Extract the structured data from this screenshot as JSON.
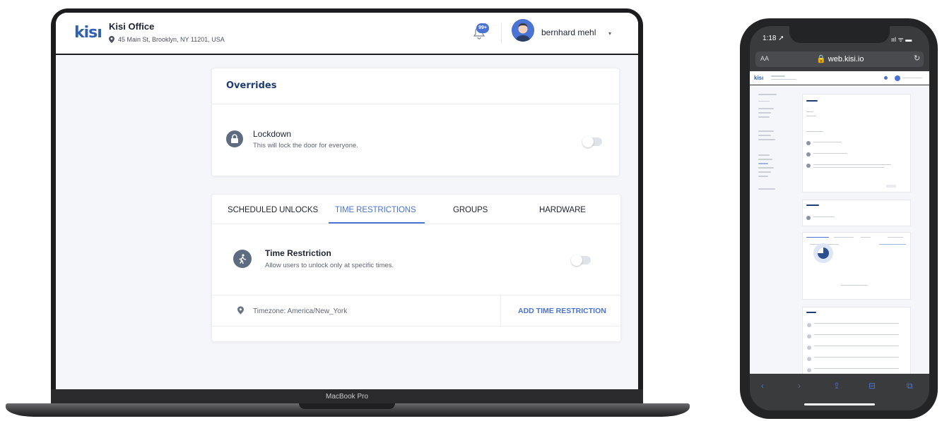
{
  "laptop": {
    "device_label": "MacBook Pro",
    "header": {
      "logo": "kisı",
      "org_name": "Kisi Office",
      "org_address": "45 Main St, Brooklyn, NY 11201, USA",
      "notification_badge": "99+",
      "user_name": "bernhard mehl",
      "caret": "▾"
    },
    "overrides": {
      "title": "Overrides",
      "lockdown": {
        "title": "Lockdown",
        "subtitle": "This will lock the door for everyone.",
        "enabled": false
      }
    },
    "tabs": [
      {
        "label": "SCHEDULED UNLOCKS",
        "active": false
      },
      {
        "label": "TIME RESTRICTIONS",
        "active": true
      },
      {
        "label": "GROUPS",
        "active": false
      },
      {
        "label": "HARDWARE",
        "active": false
      }
    ],
    "time_restriction": {
      "title": "Time Restriction",
      "subtitle": "Allow users to unlock only at specific times.",
      "enabled": false,
      "timezone": "Timezone: America/New_York",
      "add_label": "ADD TIME RESTRICTION"
    },
    "colors": {
      "accent": "#4a73d4",
      "title_blue": "#1e3d73",
      "icon_gray": "#5d6c80"
    }
  },
  "phone": {
    "status_time": "1:18 ➚",
    "status_icons": "ııl ᯤ ▬",
    "url_aa": "AA",
    "url": "🔒 web.kisi.io",
    "reload_icon": "↻",
    "mini_logo": "kisı",
    "toolbar_icons": [
      "‹",
      "›",
      "⇪",
      "⊟",
      "⧉"
    ]
  }
}
